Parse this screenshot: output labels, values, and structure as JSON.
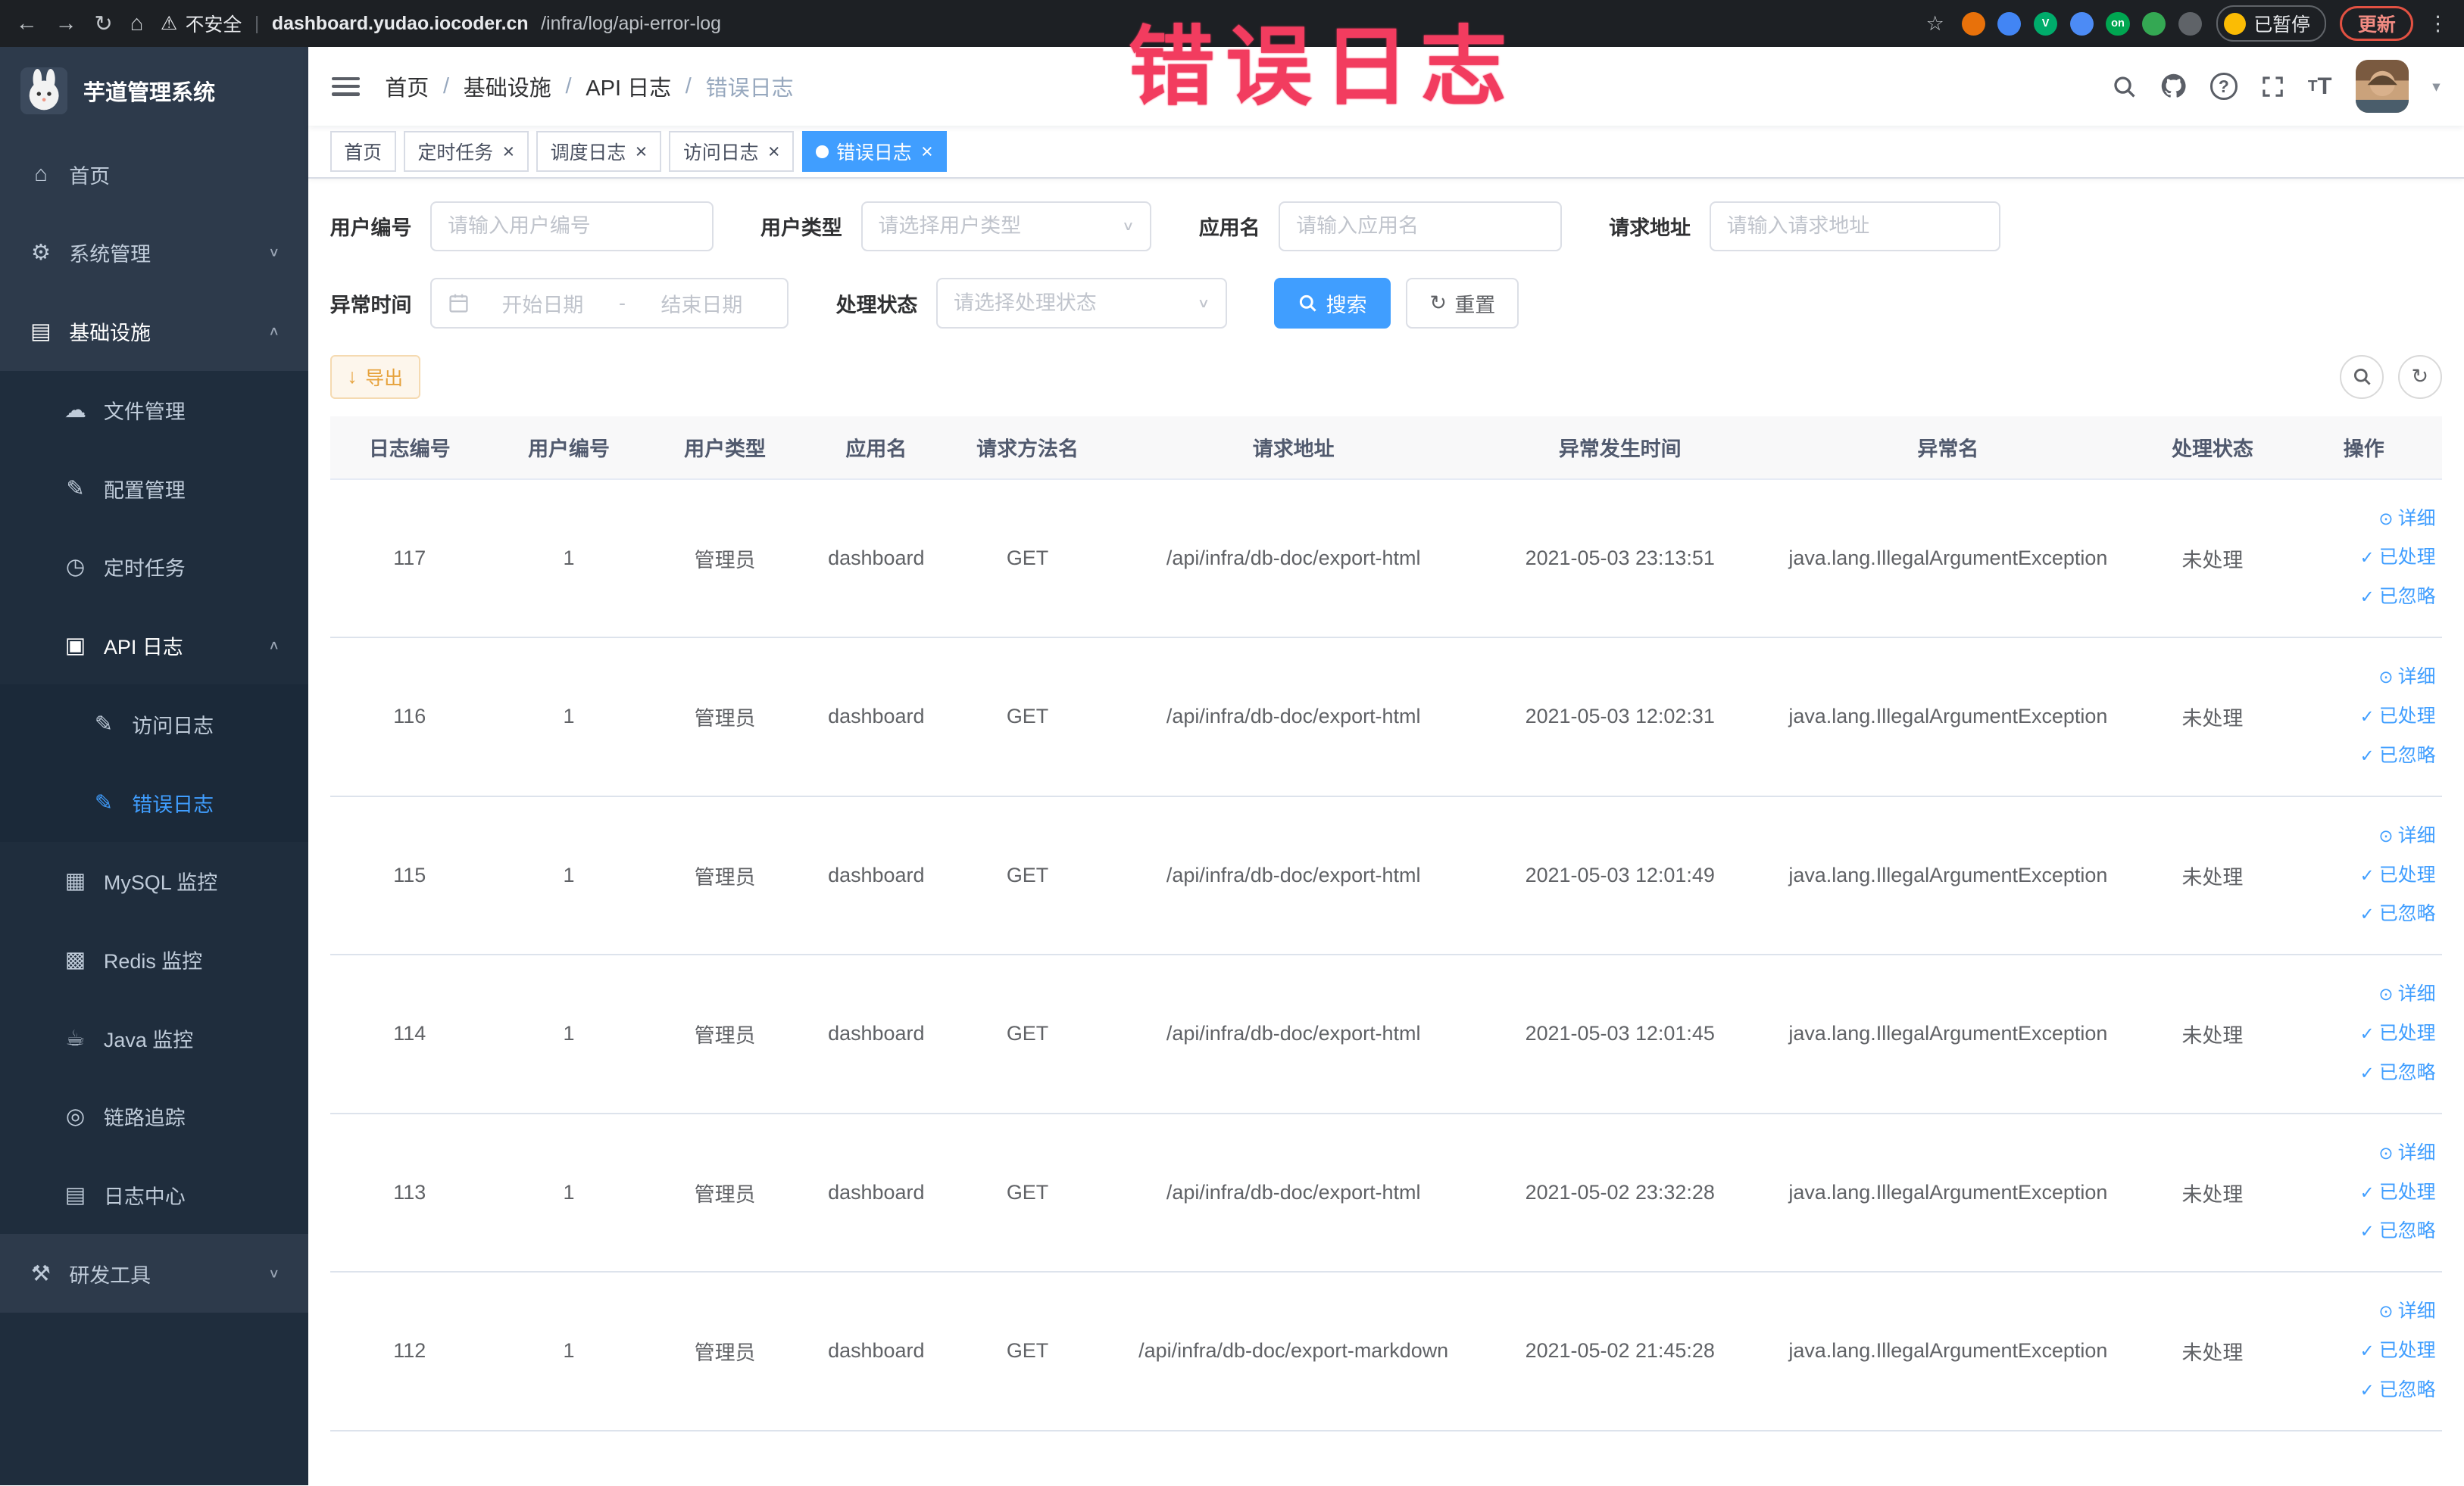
{
  "annotation": "错误日志",
  "browser": {
    "security_label": "不安全",
    "url_host": "dashboard.yudao.iocoder.cn",
    "url_path": "/infra/log/api-error-log",
    "paused_label": "已暂停",
    "update_label": "更新",
    "extensions": [
      {
        "color": "#e8710a",
        "text": ""
      },
      {
        "color": "#4285f4",
        "text": ""
      },
      {
        "color": "#00ac6b",
        "text": "V"
      },
      {
        "color": "#4c8bf5",
        "text": ""
      },
      {
        "color": "#00a651",
        "text": "on"
      },
      {
        "color": "#34a853",
        "text": ""
      },
      {
        "color": "#5f6368",
        "text": ""
      }
    ]
  },
  "sidebar": {
    "logo_title": "芋道管理系统",
    "items": [
      {
        "id": "home",
        "label": "首页",
        "icon": "home-icon",
        "level": 1
      },
      {
        "id": "system",
        "label": "系统管理",
        "icon": "gear-icon",
        "level": 1,
        "arrow": "down"
      },
      {
        "id": "infra",
        "label": "基础设施",
        "icon": "infra-icon",
        "level": 1,
        "arrow": "up",
        "open": true
      },
      {
        "id": "file",
        "label": "文件管理",
        "icon": "file-icon",
        "level": 2
      },
      {
        "id": "config",
        "label": "配置管理",
        "icon": "config-icon",
        "level": 2
      },
      {
        "id": "job",
        "label": "定时任务",
        "icon": "job-icon",
        "level": 2
      },
      {
        "id": "api-log",
        "label": "API 日志",
        "icon": "api-log-icon",
        "level": 2,
        "arrow": "up",
        "open": true
      },
      {
        "id": "access-log",
        "label": "访问日志",
        "icon": "edit-log-icon",
        "level": 3
      },
      {
        "id": "error-log",
        "label": "错误日志",
        "icon": "edit-log-icon",
        "level": 3,
        "active": true
      },
      {
        "id": "mysql",
        "label": "MySQL 监控",
        "icon": "mysql-icon",
        "level": 2
      },
      {
        "id": "redis",
        "label": "Redis 监控",
        "icon": "redis-icon",
        "level": 2
      },
      {
        "id": "java",
        "label": "Java 监控",
        "icon": "java-icon",
        "level": 2
      },
      {
        "id": "trace",
        "label": "链路追踪",
        "icon": "trace-icon",
        "level": 2
      },
      {
        "id": "log-center",
        "label": "日志中心",
        "icon": "log-center-icon",
        "level": 2
      },
      {
        "id": "dev-tools",
        "label": "研发工具",
        "icon": "tools-icon",
        "level": 1,
        "arrow": "down"
      }
    ]
  },
  "icons": {
    "home-icon": "⌂",
    "gear-icon": "⚙",
    "infra-icon": "▤",
    "file-icon": "☁",
    "config-icon": "✎",
    "job-icon": "◷",
    "api-log-icon": "▣",
    "edit-log-icon": "✎",
    "mysql-icon": "▦",
    "redis-icon": "▩",
    "java-icon": "☕",
    "trace-icon": "◎",
    "log-center-icon": "▤",
    "tools-icon": "⚒"
  },
  "navbar": {
    "breadcrumb": [
      "首页",
      "基础设施",
      "API 日志",
      "错误日志"
    ]
  },
  "tabs": [
    {
      "id": "home",
      "label": "首页",
      "closable": false,
      "active": false
    },
    {
      "id": "cron-job",
      "label": "定时任务",
      "closable": true,
      "active": false
    },
    {
      "id": "job-log",
      "label": "调度日志",
      "closable": true,
      "active": false
    },
    {
      "id": "access-log",
      "label": "访问日志",
      "closable": true,
      "active": false
    },
    {
      "id": "error-log",
      "label": "错误日志",
      "closable": true,
      "active": true
    }
  ],
  "filters": {
    "user_id": {
      "label": "用户编号",
      "placeholder": "请输入用户编号"
    },
    "user_type": {
      "label": "用户类型",
      "placeholder": "请选择用户类型"
    },
    "app_name": {
      "label": "应用名",
      "placeholder": "请输入应用名"
    },
    "request_url": {
      "label": "请求地址",
      "placeholder": "请输入请求地址"
    },
    "exception_time": {
      "label": "异常时间",
      "start_placeholder": "开始日期",
      "separator": "-",
      "end_placeholder": "结束日期"
    },
    "process_status": {
      "label": "处理状态",
      "placeholder": "请选择处理状态"
    },
    "search_label": "搜索",
    "reset_label": "重置"
  },
  "toolbar": {
    "export_label": "导出"
  },
  "table": {
    "columns": [
      "日志编号",
      "用户编号",
      "用户类型",
      "应用名",
      "请求方法名",
      "请求地址",
      "异常发生时间",
      "异常名",
      "处理状态",
      "操作"
    ],
    "row_actions": [
      {
        "id": "detail",
        "label": "详细",
        "icon": "eye-icon",
        "glyph": "⊙"
      },
      {
        "id": "processed",
        "label": "已处理",
        "icon": "check-icon",
        "glyph": "✓"
      },
      {
        "id": "ignore",
        "label": "已忽略",
        "icon": "check-icon",
        "glyph": "✓"
      }
    ],
    "rows": [
      {
        "log_id": "117",
        "user_id": "1",
        "user_type": "管理员",
        "app_name": "dashboard",
        "method": "GET",
        "url": "/api/infra/db-doc/export-html",
        "time": "2021-05-03 23:13:51",
        "exception": "java.lang.IllegalArgumentException",
        "status": "未处理"
      },
      {
        "log_id": "116",
        "user_id": "1",
        "user_type": "管理员",
        "app_name": "dashboard",
        "method": "GET",
        "url": "/api/infra/db-doc/export-html",
        "time": "2021-05-03 12:02:31",
        "exception": "java.lang.IllegalArgumentException",
        "status": "未处理"
      },
      {
        "log_id": "115",
        "user_id": "1",
        "user_type": "管理员",
        "app_name": "dashboard",
        "method": "GET",
        "url": "/api/infra/db-doc/export-html",
        "time": "2021-05-03 12:01:49",
        "exception": "java.lang.IllegalArgumentException",
        "status": "未处理"
      },
      {
        "log_id": "114",
        "user_id": "1",
        "user_type": "管理员",
        "app_name": "dashboard",
        "method": "GET",
        "url": "/api/infra/db-doc/export-html",
        "time": "2021-05-03 12:01:45",
        "exception": "java.lang.IllegalArgumentException",
        "status": "未处理"
      },
      {
        "log_id": "113",
        "user_id": "1",
        "user_type": "管理员",
        "app_name": "dashboard",
        "method": "GET",
        "url": "/api/infra/db-doc/export-html",
        "time": "2021-05-02 23:32:28",
        "exception": "java.lang.IllegalArgumentException",
        "status": "未处理"
      },
      {
        "log_id": "112",
        "user_id": "1",
        "user_type": "管理员",
        "app_name": "dashboard",
        "method": "GET",
        "url": "/api/infra/db-doc/export-markdown",
        "time": "2021-05-02 21:45:28",
        "exception": "java.lang.IllegalArgumentException",
        "status": "未处理"
      }
    ]
  },
  "colors": {
    "primary": "#409eff",
    "sidebar_bg": "#2d3a4b",
    "submenu_bg": "#1f2d3d",
    "annotation_red": "#f23c5f",
    "warning": "#e6a23c"
  }
}
